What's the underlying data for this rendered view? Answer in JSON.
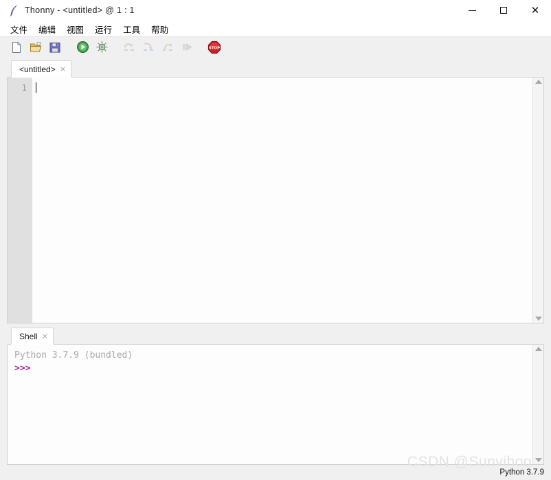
{
  "window": {
    "title": "Thonny  -  <untitled>  @  1 : 1",
    "logo_icon": "feather-quill-icon",
    "controls": {
      "minimize": "minimize-icon",
      "maximize": "maximize-icon",
      "close": "close-icon"
    }
  },
  "menubar": {
    "items": [
      {
        "label": "文件",
        "name": "menu-file"
      },
      {
        "label": "编辑",
        "name": "menu-edit"
      },
      {
        "label": "视图",
        "name": "menu-view"
      },
      {
        "label": "运行",
        "name": "menu-run"
      },
      {
        "label": "工具",
        "name": "menu-tools"
      },
      {
        "label": "帮助",
        "name": "menu-help"
      }
    ]
  },
  "toolbar": {
    "buttons": [
      {
        "icon": "new-file-icon",
        "enabled": true
      },
      {
        "icon": "open-folder-icon",
        "enabled": true
      },
      {
        "icon": "save-icon",
        "enabled": true
      },
      {
        "icon": "run-icon",
        "enabled": true
      },
      {
        "icon": "debug-icon",
        "enabled": true
      },
      {
        "icon": "step-over-icon",
        "enabled": false
      },
      {
        "icon": "step-into-icon",
        "enabled": false
      },
      {
        "icon": "step-out-icon",
        "enabled": false
      },
      {
        "icon": "resume-icon",
        "enabled": false
      },
      {
        "icon": "stop-icon",
        "enabled": true,
        "label": "STOP"
      }
    ]
  },
  "editor": {
    "tab_label": "<untitled>",
    "tab_close": "×",
    "line_numbers": [
      "1"
    ],
    "content": ""
  },
  "shell": {
    "tab_label": "Shell",
    "tab_close": "×",
    "version_line": "Python 3.7.9 (bundled)",
    "prompt": ">>>"
  },
  "statusbar": {
    "interpreter": "Python 3.7.9"
  },
  "watermark": {
    "text": "CSDN @Sunvihoo"
  },
  "colors": {
    "accent_run": "#2f9e44",
    "accent_stop": "#cc2222",
    "prompt": "#a020a0",
    "chrome": "#f0f0f0"
  }
}
